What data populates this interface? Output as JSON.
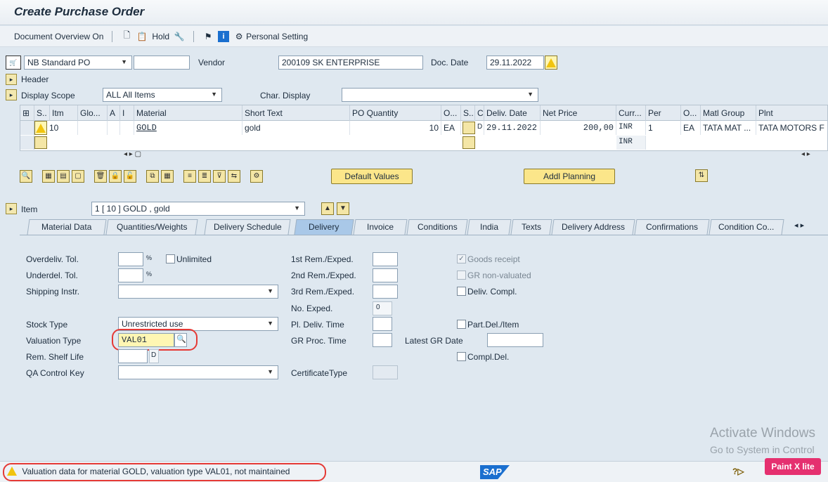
{
  "title": "Create Purchase Order",
  "toolbar": {
    "doc_overview": "Document Overview On",
    "hold": "Hold",
    "personal_setting": "Personal Setting"
  },
  "header_row": {
    "doc_type_value": "NB Standard PO",
    "vendor_label": "Vendor",
    "vendor_value": "200109 SK ENTERPRISE",
    "doc_date_label": "Doc. Date",
    "doc_date_value": "29.11.2022",
    "header_label": "Header",
    "display_scope_label": "Display Scope",
    "display_scope_value": "ALL All Items",
    "char_display_label": "Char. Display"
  },
  "grid": {
    "columns": [
      "S..",
      "Itm",
      "Glo...",
      "A",
      "I",
      "Material",
      "Short Text",
      "PO Quantity",
      "O...",
      "S..",
      "C",
      "Deliv. Date",
      "Net Price",
      "Curr...",
      "Per",
      "O...",
      "Matl Group",
      "Plnt"
    ],
    "row1": {
      "item": "10",
      "material": "GOLD",
      "short_text": "gold",
      "po_qty": "10",
      "ou": "EA",
      "c": "D",
      "deliv_date": "29.11.2022",
      "net_price": "200,00",
      "curr": "INR",
      "per": "1",
      "opu": "EA",
      "matl_group": "TATA MAT ...",
      "plant": "TATA MOTORS F"
    },
    "row2": {
      "curr": "INR"
    }
  },
  "buttons": {
    "default_values": "Default Values",
    "addl_planning": "Addl Planning"
  },
  "item_selector": {
    "label": "Item",
    "value": "1 [ 10 ] GOLD , gold"
  },
  "tabs": [
    "Material Data",
    "Quantities/Weights",
    "Delivery Schedule",
    "Delivery",
    "Invoice",
    "Conditions",
    "India",
    "Texts",
    "Delivery Address",
    "Confirmations",
    "Condition Co..."
  ],
  "active_tab": "Delivery",
  "delivery": {
    "overdeliv_label": "Overdeliv. Tol.",
    "underdeliv_label": "Underdel. Tol.",
    "pct": "%",
    "unlimited_label": "Unlimited",
    "shipping_label": "Shipping Instr.",
    "stock_type_label": "Stock Type",
    "stock_type_value": "Unrestricted use",
    "valuation_type_label": "Valuation Type",
    "valuation_type_value": "VAL01",
    "rem_shelf_label": "Rem. Shelf Life",
    "rem_shelf_unit": "D",
    "qa_control_label": "QA Control Key",
    "rem1_label": "1st Rem./Exped.",
    "rem2_label": "2nd Rem./Exped.",
    "rem3_label": "3rd Rem./Exped.",
    "no_exped_label": "No. Exped.",
    "no_exped_value": "0",
    "pl_deliv_label": "Pl. Deliv. Time",
    "gr_proc_label": "GR Proc. Time",
    "latest_gr_label": "Latest GR Date",
    "cert_type_label": "CertificateType",
    "goods_receipt_label": "Goods receipt",
    "gr_nonval_label": "GR non-valuated",
    "deliv_compl_label": "Deliv. Compl.",
    "part_del_label": "Part.Del./Item",
    "compl_del_label": "Compl.Del."
  },
  "status": {
    "message": "Valuation data for material GOLD, valuation type VAL01, not maintained"
  },
  "watermark": {
    "line1": "Activate Windows",
    "line2": "Go to System in Control"
  },
  "sap_logo_text": "SAP",
  "badge": "Paint X lite",
  "colors": {
    "accent_yellow": "#fbe68a",
    "active_tab": "#a9c8e8",
    "highlight_red": "#e53935",
    "badge_pink": "#e5306f"
  }
}
